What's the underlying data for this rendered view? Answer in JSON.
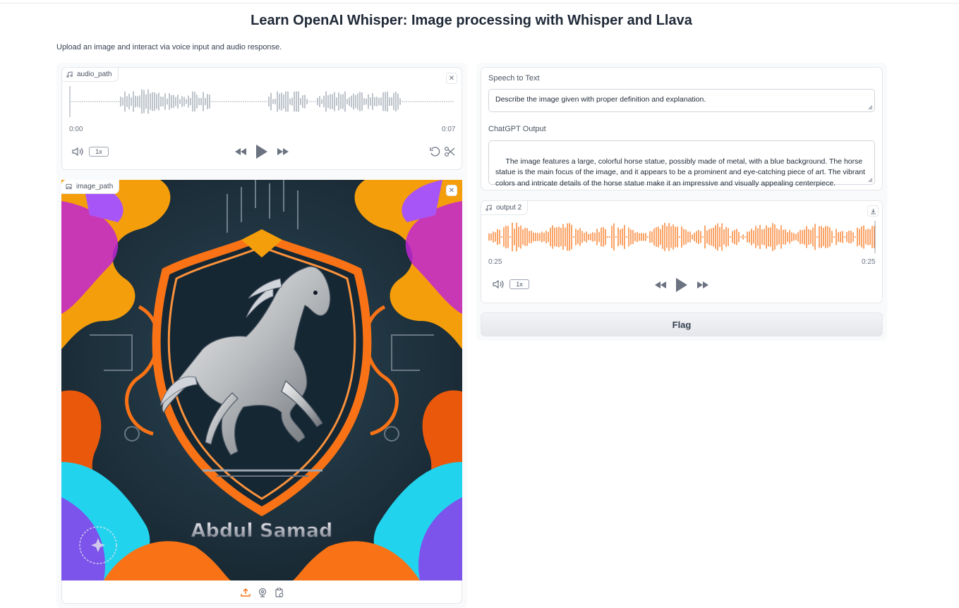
{
  "page": {
    "title": "Learn OpenAI Whisper: Image processing with Whisper and Llava",
    "description": "Upload an image and interact via voice input and audio response."
  },
  "audio_input": {
    "label": "audio_path",
    "time_start": "0:00",
    "time_end": "0:07",
    "rate": "1x",
    "wave_color": "#9ca3af"
  },
  "image_input": {
    "label": "image_path",
    "watermark_text": "Abdul Samad",
    "toolbar_icons": [
      "upload-icon",
      "webcam-icon",
      "clipboard-icon"
    ]
  },
  "speech_to_text": {
    "label": "Speech to Text",
    "value": "Describe the image given with proper definition and explanation."
  },
  "chatgpt_output": {
    "label": "ChatGPT Output",
    "value": " The image features a large, colorful horse statue, possibly made of metal, with a blue background. The horse statue is the main focus of the image, and it appears to be a prominent and eye-catching piece of art. The vibrant colors and intricate details of the horse statue make it an impressive and visually appealing centerpiece."
  },
  "audio_output": {
    "label": "output 2",
    "time_start": "0:25",
    "time_end": "0:25",
    "rate": "1x",
    "wave_color": "#f97316"
  },
  "flag_button": {
    "label": "Flag"
  },
  "colors": {
    "accent": "#f97316",
    "border": "#e5e7eb",
    "text": "#1f2937"
  }
}
